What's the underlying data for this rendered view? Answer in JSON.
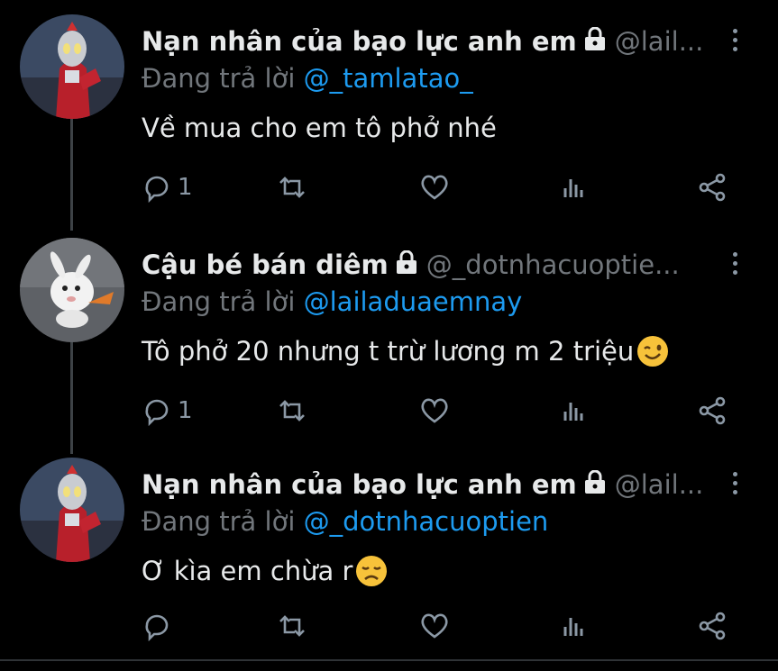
{
  "tweets": [
    {
      "name": "Nạn nhân của bạo lực anh em",
      "handle": "@lail...",
      "reply_prefix": "Đang trả lời",
      "reply_to": "@_tamlatao_",
      "text": "Về mua cho em tô phở nhé",
      "reply_count": "1",
      "avatar": "ultraman-avatar",
      "emoji": ""
    },
    {
      "name": "Cậu bé bán diêm",
      "handle": "@_dotnhacuoptie...",
      "reply_prefix": "Đang trả lời",
      "reply_to": "@lailaduaemnay",
      "text": "Tô phở 20 nhưng t trừ lương m 2 triệu",
      "reply_count": "1",
      "avatar": "rabbit-avatar",
      "emoji": "winking-face"
    },
    {
      "name": "Nạn nhân của bạo lực anh em",
      "handle": "@lail...",
      "reply_prefix": "Đang trả lời",
      "reply_to": "@_dotnhacuoptien",
      "text": "Ơ kìa em chừa r",
      "reply_count": "",
      "avatar": "ultraman-avatar",
      "emoji": "disappointed-face"
    }
  ],
  "icons": {
    "lock": "lock-icon",
    "more": "more-vertical-icon",
    "reply": "reply-icon",
    "retweet": "retweet-icon",
    "like": "heart-icon",
    "analytics": "analytics-icon",
    "share": "share-icon"
  },
  "colors": {
    "background": "#000000",
    "text": "#e7e9ea",
    "secondary": "#71767b",
    "link": "#1d9bf0",
    "emoji": "#f7c23a"
  }
}
